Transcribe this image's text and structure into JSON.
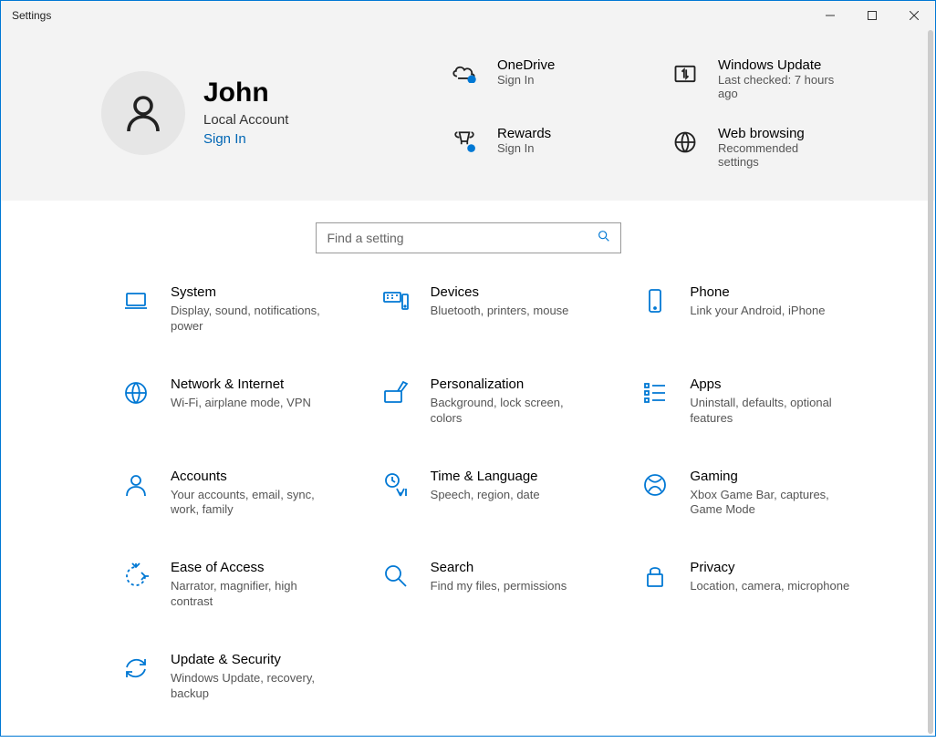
{
  "window": {
    "title": "Settings"
  },
  "user": {
    "name": "John",
    "account_type": "Local Account",
    "sign_in_label": "Sign In"
  },
  "tiles": {
    "onedrive": {
      "title": "OneDrive",
      "subtitle": "Sign In"
    },
    "windows_update": {
      "title": "Windows Update",
      "subtitle": "Last checked: 7 hours ago"
    },
    "rewards": {
      "title": "Rewards",
      "subtitle": "Sign In"
    },
    "web_browsing": {
      "title": "Web browsing",
      "subtitle": "Recommended settings"
    }
  },
  "search": {
    "placeholder": "Find a setting"
  },
  "categories": {
    "system": {
      "title": "System",
      "desc": "Display, sound, notifications, power"
    },
    "devices": {
      "title": "Devices",
      "desc": "Bluetooth, printers, mouse"
    },
    "phone": {
      "title": "Phone",
      "desc": "Link your Android, iPhone"
    },
    "network": {
      "title": "Network & Internet",
      "desc": "Wi-Fi, airplane mode, VPN"
    },
    "personalization": {
      "title": "Personalization",
      "desc": "Background, lock screen, colors"
    },
    "apps": {
      "title": "Apps",
      "desc": "Uninstall, defaults, optional features"
    },
    "accounts": {
      "title": "Accounts",
      "desc": "Your accounts, email, sync, work, family"
    },
    "time": {
      "title": "Time & Language",
      "desc": "Speech, region, date"
    },
    "gaming": {
      "title": "Gaming",
      "desc": "Xbox Game Bar, captures, Game Mode"
    },
    "ease": {
      "title": "Ease of Access",
      "desc": "Narrator, magnifier, high contrast"
    },
    "search_cat": {
      "title": "Search",
      "desc": "Find my files, permissions"
    },
    "privacy": {
      "title": "Privacy",
      "desc": "Location, camera, microphone"
    },
    "update": {
      "title": "Update & Security",
      "desc": "Windows Update, recovery, backup"
    }
  }
}
